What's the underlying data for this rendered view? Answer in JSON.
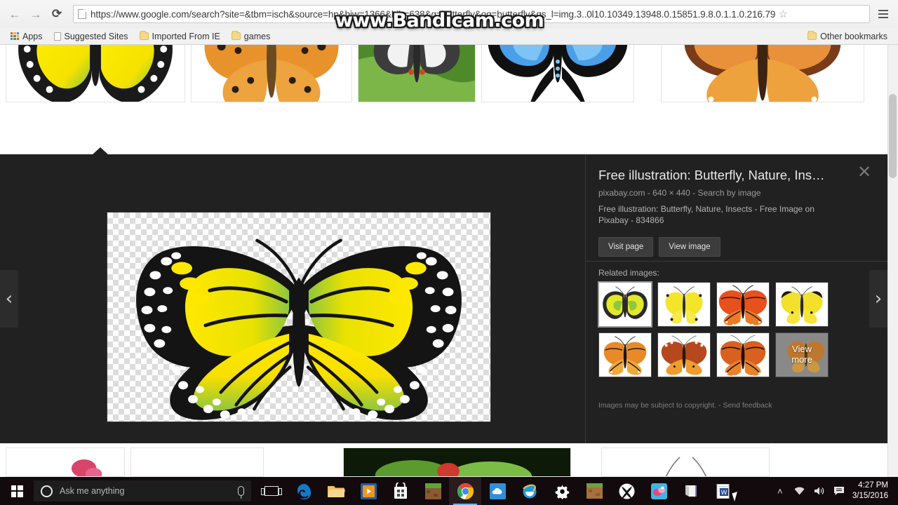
{
  "browser": {
    "back_label": "←",
    "forward_label": "→",
    "reload_label": "⟳",
    "url_text": "https://www.google.com/search?site=&tbm=isch&source=hp&biw=1366&bih=638&q=butterfly&oq=butterfly&gs_l=img.3..0l10.10349.13948.0.15851.9.8.0.1.1.0.216.79",
    "star_label": "☆",
    "bookmarks": [
      {
        "label": "Apps",
        "icon": "apps-grid-icon"
      },
      {
        "label": "Suggested Sites",
        "icon": "document-icon"
      },
      {
        "label": "Imported From IE",
        "icon": "folder-icon"
      },
      {
        "label": "games",
        "icon": "folder-icon"
      }
    ],
    "other_bookmarks": "Other bookmarks",
    "status_url": "https://pixabay.com/en/butterfly-nature-insects-834866/"
  },
  "watermark": {
    "text": "www.Bandicam.com"
  },
  "lightbox": {
    "prev_label": "‹",
    "next_label": "›",
    "close_label": "✕",
    "title": "Free illustration: Butterfly, Nature, Ins…",
    "meta": "pixabay.com - 640 × 440 - Search by image",
    "description": "Free illustration: Butterfly, Nature, Insects - Free Image on Pixabay - 834866",
    "visit_page_label": "Visit page",
    "view_image_label": "View image",
    "related_label": "Related images:",
    "view_more_label_line1": "View",
    "view_more_label_line2": "more",
    "copyright_text": "Images may be subject to copyright.",
    "copyright_sep": "-",
    "send_feedback_label": "Send feedback"
  },
  "search_results": {
    "top_row": [
      {
        "alt": "yellow-green-butterfly-illustration",
        "selected": true
      },
      {
        "alt": "orange-spotted-fritillary-butterfly",
        "selected": false
      },
      {
        "alt": "lime-swallowtail-butterfly-on-leaf",
        "selected": false
      },
      {
        "alt": "blue-swallowtail-butterfly",
        "selected": false
      },
      {
        "alt": "orange-monarch-butterfly",
        "selected": false
      }
    ],
    "related_images": [
      {
        "alt": "yellow-green-butterfly-illustration",
        "selected": true
      },
      {
        "alt": "yellow-butterfly-small",
        "selected": false
      },
      {
        "alt": "orange-monarch-butterfly",
        "selected": false
      },
      {
        "alt": "yellow-black-tipped-butterfly",
        "selected": false
      },
      {
        "alt": "orange-yellow-monarch",
        "selected": false
      },
      {
        "alt": "orange-tiger-butterfly",
        "selected": false
      },
      {
        "alt": "dark-orange-monarch",
        "selected": false
      },
      {
        "alt": "view-more-tile",
        "selected": false
      }
    ],
    "bottom_row": [
      {
        "alt": "pink-flower-butterfly"
      },
      {
        "alt": "white-background-butterfly"
      },
      {
        "alt": "green-leaf-butterfly"
      },
      {
        "alt": "orange-wing-butterfly"
      }
    ]
  },
  "taskbar": {
    "start_label": "start-button",
    "cortana_placeholder": "Ask me anything",
    "mic_label": "microphone-icon",
    "items": [
      {
        "name": "task-view",
        "label": "Task View"
      },
      {
        "name": "edge",
        "label": "Microsoft Edge"
      },
      {
        "name": "file-explorer",
        "label": "File Explorer"
      },
      {
        "name": "media-player",
        "label": "Media Player"
      },
      {
        "name": "store",
        "label": "Microsoft Store"
      },
      {
        "name": "minecraft",
        "label": "Minecraft"
      },
      {
        "name": "chrome",
        "label": "Google Chrome",
        "active": true
      },
      {
        "name": "onedrive",
        "label": "OneDrive"
      },
      {
        "name": "internet-explorer",
        "label": "Internet Explorer"
      },
      {
        "name": "settings",
        "label": "Settings"
      },
      {
        "name": "game",
        "label": "Game"
      },
      {
        "name": "xbox",
        "label": "Xbox"
      },
      {
        "name": "photos",
        "label": "Photos"
      },
      {
        "name": "onenote",
        "label": "OneNote"
      },
      {
        "name": "word",
        "label": "Microsoft Word"
      }
    ],
    "tray": {
      "chevron_label": "˄",
      "network_label": "wifi-icon",
      "volume_label": "volume-icon",
      "action_center_label": "action-center-icon",
      "time": "4:27 PM",
      "date": "3/15/2016"
    }
  },
  "colors": {
    "lightbox_bg": "#212121",
    "button_bg": "#3c3c3c",
    "accent": "#6ab4e8",
    "taskbar_bg": "#120a0c"
  }
}
